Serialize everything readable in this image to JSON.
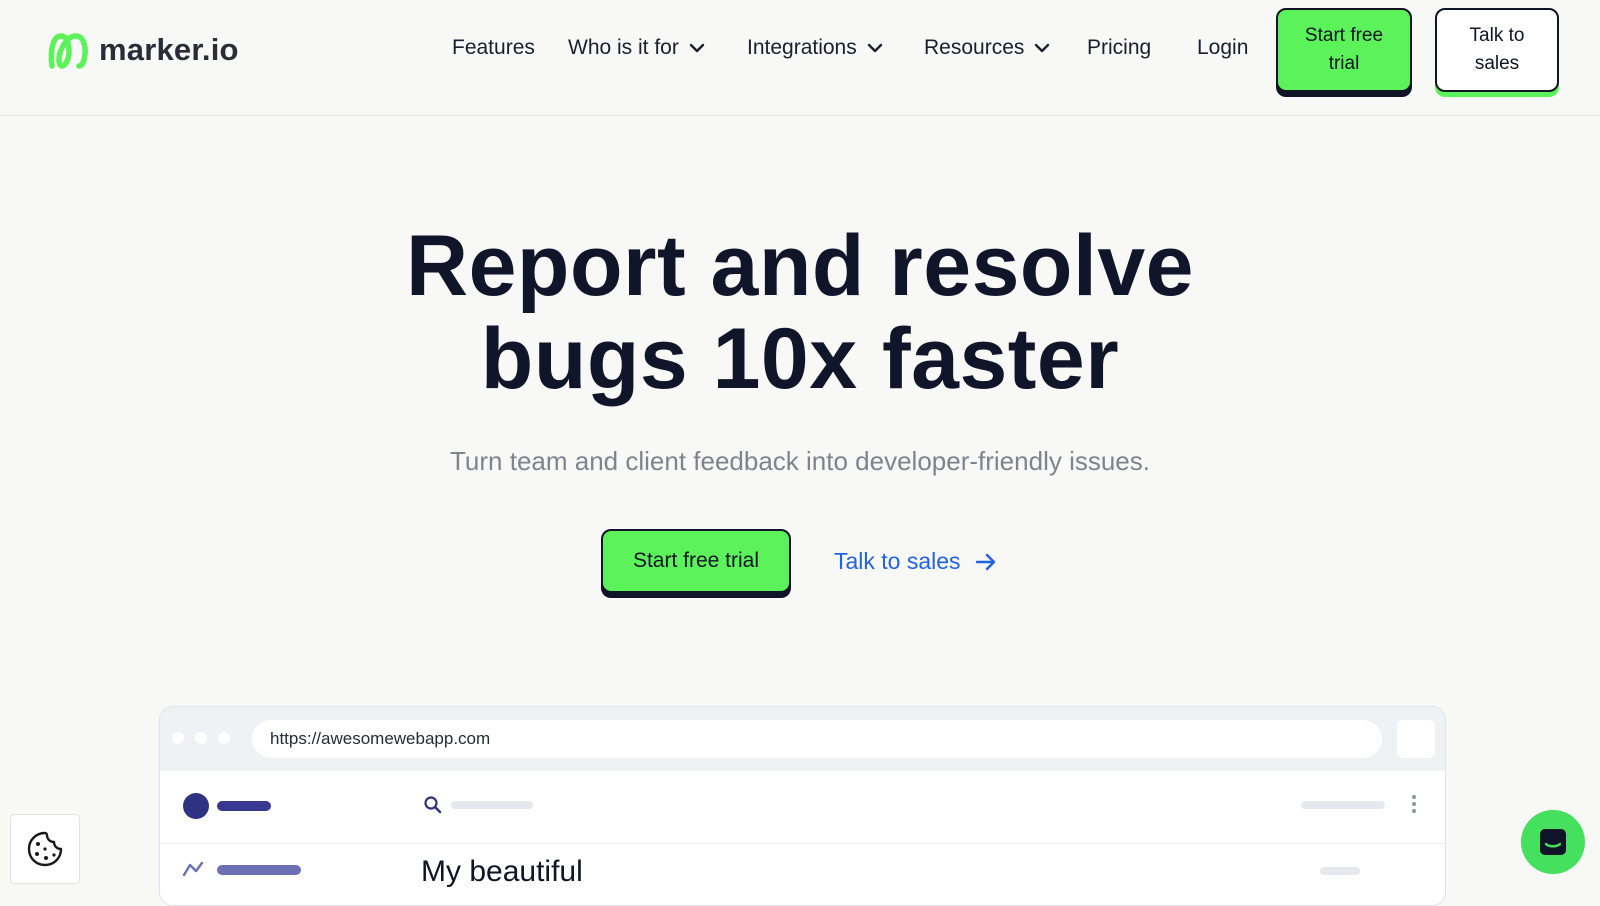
{
  "header": {
    "logo_text": "marker.io",
    "nav": {
      "features": "Features",
      "who": "Who is it for",
      "integrations": "Integrations",
      "resources": "Resources",
      "pricing": "Pricing",
      "login": "Login"
    },
    "start_trial": "Start free trial",
    "talk_sales": "Talk to sales"
  },
  "hero": {
    "title_line1": "Report and resolve",
    "title_line2": "bugs 10x faster",
    "subtitle": "Turn team and client feedback into developer-friendly issues.",
    "cta_primary": "Start free trial",
    "cta_secondary": "Talk to sales"
  },
  "mockup": {
    "url": "https://awesomewebapp.com",
    "row_title": "My beautiful"
  },
  "icons": {
    "logo": "marker-logo-icon",
    "chevron": "chevron-down-icon",
    "arrow": "arrow-right-icon",
    "search": "search-icon",
    "cookie": "cookie-icon",
    "chat": "chat-icon"
  },
  "colors": {
    "accent_green": "#5cf25a",
    "ink": "#0f1426",
    "link_blue": "#1f63e6",
    "subtitle_gray": "#80838f",
    "mock_navy": "#2f3183"
  }
}
